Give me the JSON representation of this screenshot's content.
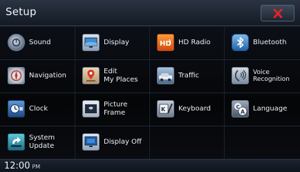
{
  "header": {
    "title": "Setup"
  },
  "tiles": [
    {
      "label": "Sound",
      "icon": "sound-icon"
    },
    {
      "label": "Display",
      "icon": "display-icon"
    },
    {
      "label": "HD Radio",
      "icon": "hd-radio-icon"
    },
    {
      "label": "Bluetooth",
      "icon": "bluetooth-icon"
    },
    {
      "label": "Navigation",
      "icon": "navigation-icon"
    },
    {
      "label": "Edit\nMy Places",
      "icon": "my-places-icon"
    },
    {
      "label": "Traffic",
      "icon": "traffic-icon"
    },
    {
      "label": "Voice\nRecognition",
      "icon": "voice-recognition-icon"
    },
    {
      "label": "Clock",
      "icon": "clock-icon"
    },
    {
      "label": "Picture\nFrame",
      "icon": "picture-frame-icon"
    },
    {
      "label": "Keyboard",
      "icon": "keyboard-icon"
    },
    {
      "label": "Language",
      "icon": "language-icon"
    },
    {
      "label": "System\nUpdate",
      "icon": "system-update-icon"
    },
    {
      "label": "Display Off",
      "icon": "display-off-icon"
    }
  ],
  "status": {
    "time": "12:00",
    "ampm": "PM"
  },
  "colors": {
    "close": "#e0242b",
    "accent": "#3a8fd6"
  }
}
